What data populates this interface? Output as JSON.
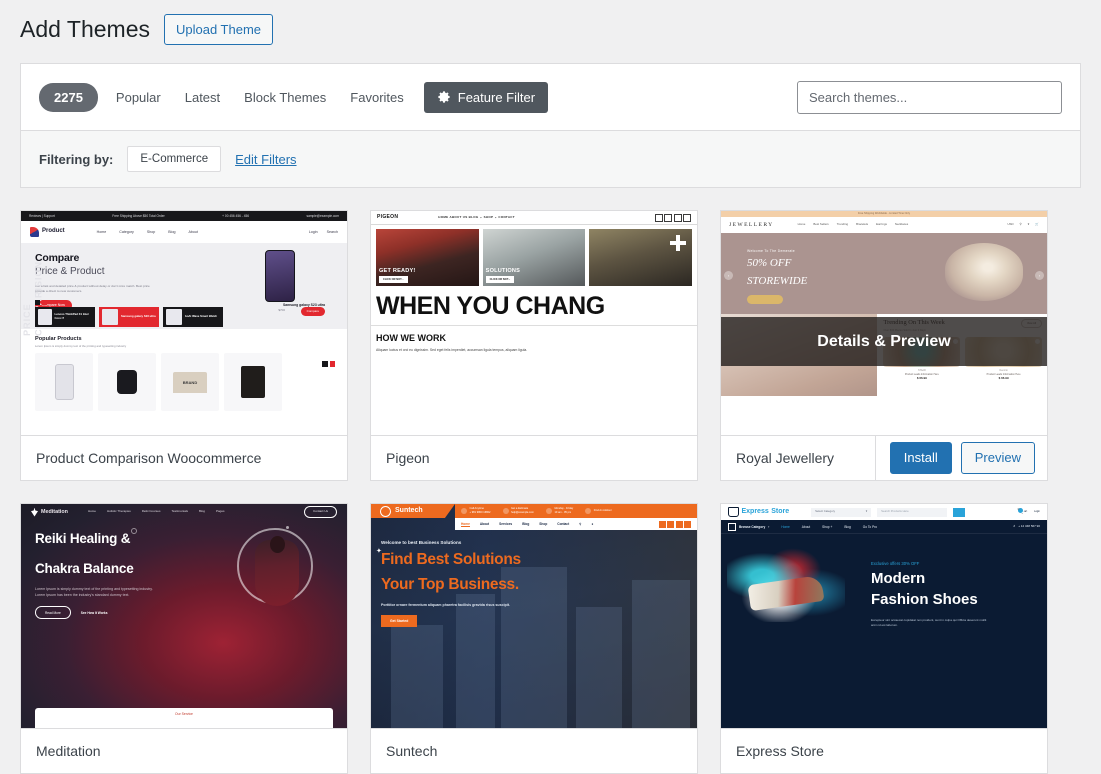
{
  "header": {
    "title": "Add Themes",
    "upload_button": "Upload Theme"
  },
  "filter_bar": {
    "count": "2275",
    "tabs": [
      {
        "label": "Popular"
      },
      {
        "label": "Latest"
      },
      {
        "label": "Block Themes"
      },
      {
        "label": "Favorites"
      }
    ],
    "feature_filter": "Feature Filter",
    "feature_filter_icon": "gear-icon",
    "search_placeholder": "Search themes..."
  },
  "filtering": {
    "label": "Filtering by:",
    "chips": [
      "E-Commerce"
    ],
    "edit_link": "Edit Filters"
  },
  "card_actions": {
    "details_preview": "Details & Preview",
    "install": "Install",
    "preview": "Preview"
  },
  "themes": [
    {
      "name": "Product Comparison Woocommerce",
      "hovered": false,
      "screenshot": {
        "topbar_left": "Reviews | Support",
        "topbar_center": "Free Shipping Above $50 Total Order",
        "topbar_phone": "+ 00 456 456 - 456",
        "topbar_mail": "sample@example.com",
        "logo": "Product",
        "logo_sub": "Comparison",
        "nav": [
          "Home",
          "Category",
          "Shop",
          "Blog",
          "About"
        ],
        "login": "Login",
        "search": "Search",
        "watermark": "PRICE COMPARISION",
        "hero_title": "Compare",
        "hero_title2": "Price & Product",
        "hero_text": "Get a fast and detailed price & product without delay or don't miss match. Best price provide a direct to new customers.",
        "hero_cta": "Compare Now",
        "phone_name": "Samsung galaxy S23 ultra",
        "phone_price": "$700",
        "phone_cta": "Compare",
        "cards": [
          {
            "title": "Lenovo ThinkPad X1 Intel Core i7",
            "price": "$2,40"
          },
          {
            "title": "Samsung galaxy S23 ultra",
            "price": "$700"
          },
          {
            "title": "boAt Wave Smart Watch",
            "price": "$2,40"
          }
        ],
        "popular_title": "Popular  Products",
        "popular_sub": "Lorem Ipsum is simply dummy text of the printing and typesetting industry",
        "product_badge": "BRAND"
      }
    },
    {
      "name": "Pigeon",
      "hovered": false,
      "screenshot": {
        "logo": "PIGEON",
        "nav": "HOME  ABOUT US  BLOG ⌄  SHOP ⌄  CONTACT",
        "tiles": [
          {
            "caption": "GET READY!",
            "button": "CLICK OR NOT..."
          },
          {
            "caption": "SOLUTIONS",
            "button": "CLICK OR NOT..."
          },
          {
            "caption": "",
            "button": ""
          }
        ],
        "headline": "WHEN YOU CHANG",
        "section_title": "HOW WE WORK",
        "section_text": "Aliquam luctus et orci eu dignissim. Sed eget felis imperdiet, accumsan ligula tempus, aliquam ligula."
      }
    },
    {
      "name": "Royal Jewellery",
      "hovered": true,
      "screenshot": {
        "announcement": "Free Shipping Worldwide - Limited Time Only",
        "logo": "JEWELLERY",
        "nav": [
          "Home",
          "Best Sellers",
          "Trending",
          "Bracelets",
          "Earrings",
          "Necklaces"
        ],
        "currency": "USD",
        "hero_welcome": "Welcome To The Demerate",
        "hero_title": "50% OFF",
        "hero_title2": "STOREWIDE",
        "hero_cta": "SHOP NOW",
        "trending_title": "Trending On This Week",
        "trending_sub": "Over 500 Pieces Sold In Just 3 Days",
        "view_all": "View All",
        "items": [
          {
            "brand": "STAAR",
            "name": "Product Leads Information Here",
            "price": "$ 66.99",
            "old": "$ 80.34"
          },
          {
            "brand": "Decorio",
            "name": "Product Leads Information Here",
            "price": "$ 66.99",
            "old": "$ 80.34"
          }
        ]
      }
    },
    {
      "name": "Meditation",
      "hovered": false,
      "screenshot": {
        "logo": "Meditation",
        "nav": [
          "Home",
          "Holistic Therapies",
          "Reiki Courses",
          "Testimonials",
          "Blog",
          "Pages"
        ],
        "cta_top": "Contact Us",
        "hero_title": "Reiki Healing &",
        "hero_title2": "Chakra Balance",
        "hero_text": "Lorem Ipsum is simply dummy text of the printing and typesetting industry. Lorem Ipsum has been the industry's standard dummy text.",
        "btn1": "Read More",
        "btn2": "See How It Works",
        "card_label": "Our Service"
      }
    },
    {
      "name": "Suntech",
      "hovered": false,
      "screenshot": {
        "logo": "Suntech",
        "contacts": [
          {
            "label": "Call Anytime",
            "value": "+ 981 9800 16802"
          },
          {
            "label": "Get a Estimate",
            "value": "help@example.com"
          },
          {
            "label": "Monday - Friday",
            "value": "10 am - 05 pm"
          }
        ],
        "advisor": "Find An Advisor",
        "nav": [
          "Home",
          "About",
          "Services",
          "Blog",
          "Shop",
          "Contact"
        ],
        "welcome": "Welcome to best Business Solutions",
        "hero_title": "Find Best Solutions",
        "hero_title2": "Your Top Business.",
        "hero_text": "Porttitor ornare fermentum aliquam pharetra facilisis gravida risus suscipit.",
        "hero_cta": "Get Started"
      }
    },
    {
      "name": "Express Store",
      "hovered": false,
      "screenshot": {
        "logo": "Express",
        "logo2": "Store",
        "category_select": "Select Category",
        "search_placeholder": "Search Products Here",
        "cart_label": "Cart",
        "cart_count": "0",
        "login_label": "Login",
        "browse": "Browse Category",
        "nav": [
          "Home",
          "About",
          "Shop +",
          "Blog",
          "Go To Pro"
        ],
        "phone": "+ 12 348 567 90",
        "offer": "Exclusive offers 30% OFF",
        "hero_title": "Modern",
        "hero_title2": "Fashion Shoes",
        "hero_text": "Excepteur sint occaecat cupidatat non proident, sunt in culpa qui Officia deserunt mollit anim id est laborum."
      }
    }
  ]
}
